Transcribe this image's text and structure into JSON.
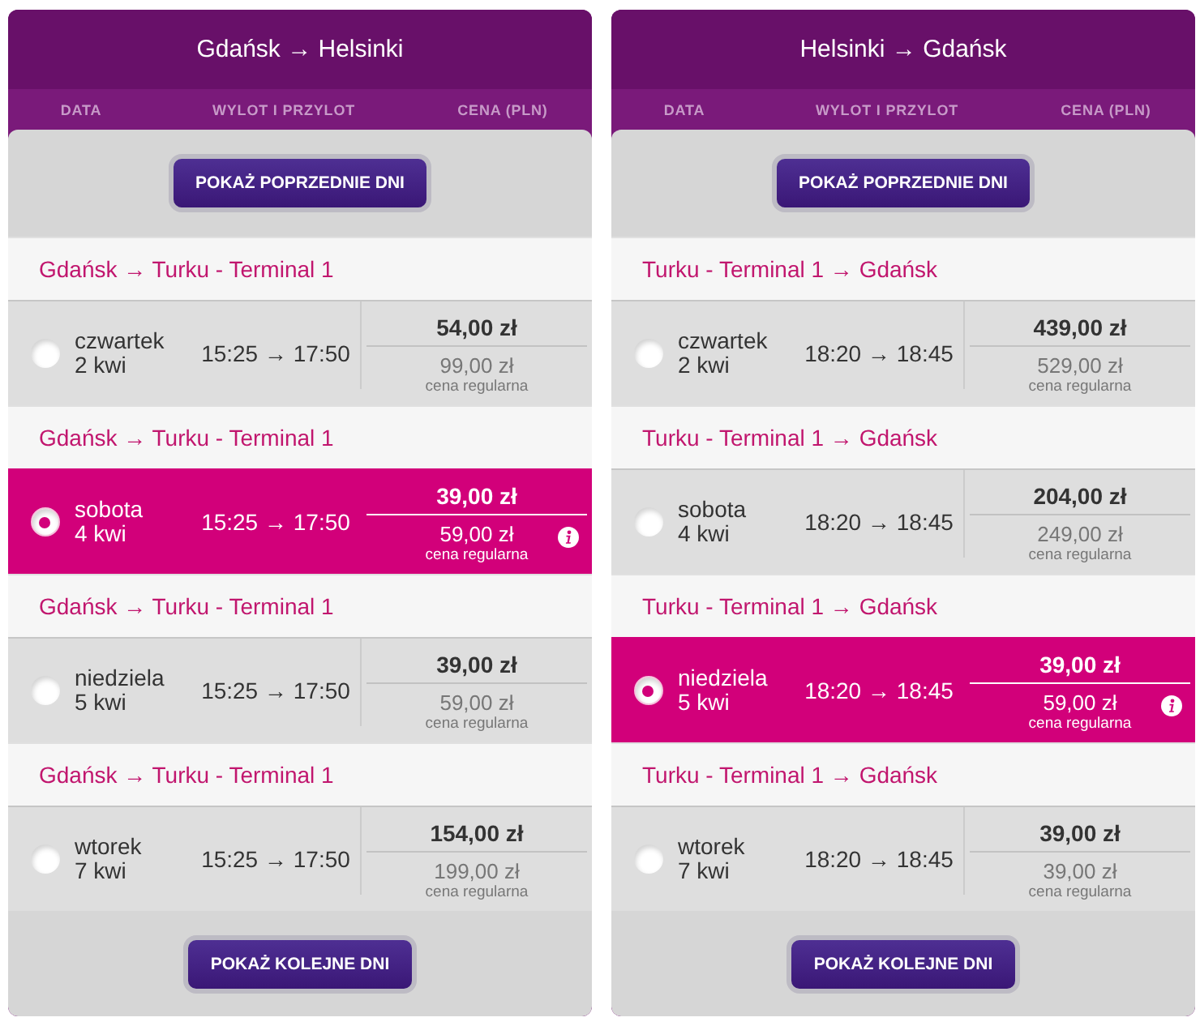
{
  "panels": [
    {
      "title": "Gdańsk → Helsinki",
      "columns": [
        "DATA",
        "WYLOT I PRZYLOT",
        "CENA (PLN)"
      ],
      "prev_button": "POKAŻ POPRZEDNIE DNI",
      "flights": [
        {
          "route": "Gdańsk → Turku - Terminal 1",
          "day": "czwartek",
          "date": "2 kwi",
          "times": "15:25 → 17:50",
          "price": "54,00 zł",
          "regular_price": "99,00 zł",
          "regular_label": "cena regularna",
          "selected": false
        },
        {
          "route": "Gdańsk → Turku - Terminal 1",
          "day": "sobota",
          "date": "4 kwi",
          "times": "15:25 → 17:50",
          "price": "39,00 zł",
          "regular_price": "59,00 zł",
          "regular_label": "cena regularna",
          "selected": true
        },
        {
          "route": "Gdańsk → Turku - Terminal 1",
          "day": "niedziela",
          "date": "5 kwi",
          "times": "15:25 → 17:50",
          "price": "39,00 zł",
          "regular_price": "59,00 zł",
          "regular_label": "cena regularna",
          "selected": false
        },
        {
          "route": "Gdańsk → Turku - Terminal 1",
          "day": "wtorek",
          "date": "7 kwi",
          "times": "15:25 → 17:50",
          "price": "154,00 zł",
          "regular_price": "199,00 zł",
          "regular_label": "cena regularna",
          "selected": false
        }
      ],
      "next_button": "POKAŻ KOLEJNE DNI"
    },
    {
      "title": "Helsinki → Gdańsk",
      "columns": [
        "DATA",
        "WYLOT I PRZYLOT",
        "CENA (PLN)"
      ],
      "prev_button": "POKAŻ POPRZEDNIE DNI",
      "flights": [
        {
          "route": "Turku - Terminal 1 → Gdańsk",
          "day": "czwartek",
          "date": "2 kwi",
          "times": "18:20 → 18:45",
          "price": "439,00 zł",
          "regular_price": "529,00 zł",
          "regular_label": "cena regularna",
          "selected": false
        },
        {
          "route": "Turku - Terminal 1 → Gdańsk",
          "day": "sobota",
          "date": "4 kwi",
          "times": "18:20 → 18:45",
          "price": "204,00 zł",
          "regular_price": "249,00 zł",
          "regular_label": "cena regularna",
          "selected": false
        },
        {
          "route": "Turku - Terminal 1 → Gdańsk",
          "day": "niedziela",
          "date": "5 kwi",
          "times": "18:20 → 18:45",
          "price": "39,00 zł",
          "regular_price": "59,00 zł",
          "regular_label": "cena regularna",
          "selected": true
        },
        {
          "route": "Turku - Terminal 1 → Gdańsk",
          "day": "wtorek",
          "date": "7 kwi",
          "times": "18:20 → 18:45",
          "price": "39,00 zł",
          "regular_price": "39,00 zł",
          "regular_label": "cena regularna",
          "selected": false
        }
      ],
      "next_button": "POKAŻ KOLEJNE DNI"
    }
  ]
}
